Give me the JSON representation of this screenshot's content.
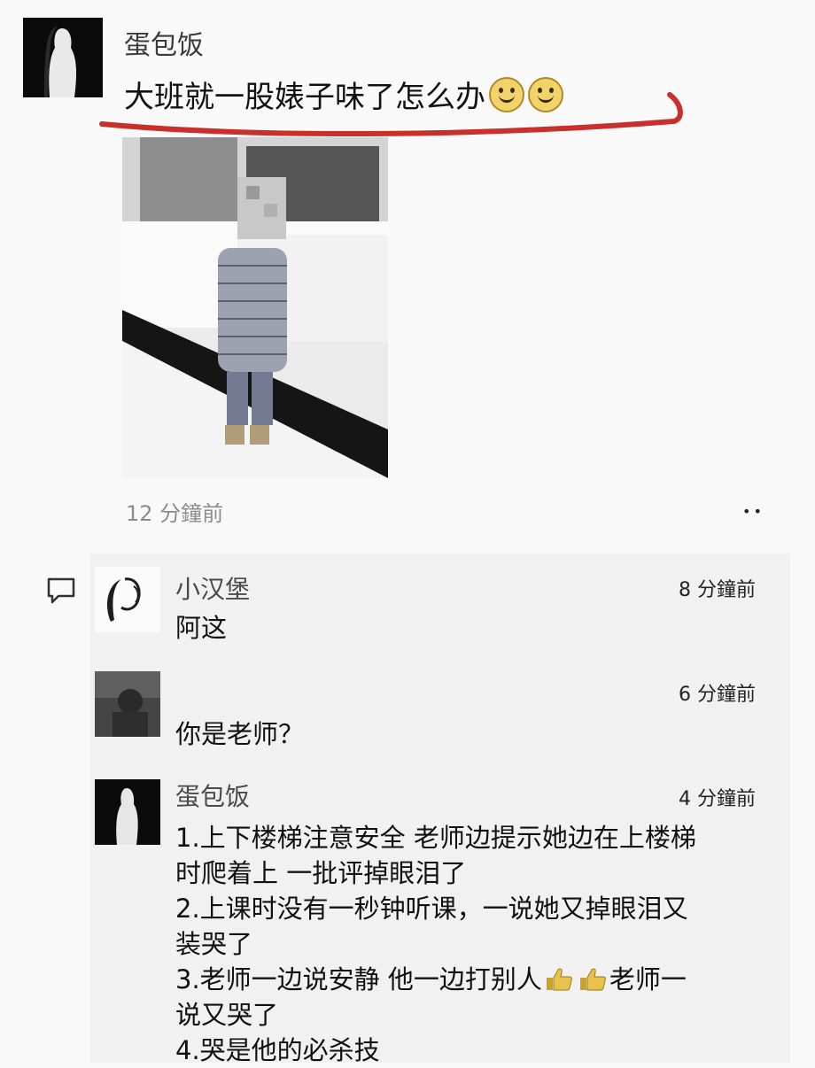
{
  "post": {
    "username": "蛋包饭",
    "text": "大班就一股婊子味了怎么办",
    "emojis": [
      "smile-icon",
      "smile-icon"
    ],
    "time": "12 分鐘前"
  },
  "comments": [
    {
      "name": "小汉堡",
      "time": "8 分鐘前",
      "text": "阿这"
    },
    {
      "name": "",
      "time": "6 分鐘前",
      "text": "你是老师？"
    },
    {
      "name": "蛋包饭",
      "time": "4 分鐘前",
      "lines": [
        "1.上下楼梯注意安全 老师边提示她边在上楼梯",
        "时爬着上 一批评掉眼泪了",
        "2.上课时没有一秒钟听课，一说她又掉眼泪又",
        "装哭了",
        "3.老师一边说安静 他一边打别人",
        "老师一",
        "说又哭了",
        "4.哭是他的必杀技"
      ]
    }
  ],
  "colors": {
    "background": "#f9f9f9",
    "comment_bg": "#f1f1f1",
    "underline": "#c9302c",
    "time_gray": "#8c8c8c"
  },
  "icons": {
    "comment": "comment-bubble-icon",
    "more": "more-icon",
    "thumbs": "thumbs-up-icon"
  },
  "ui": {
    "more_label": "••"
  }
}
